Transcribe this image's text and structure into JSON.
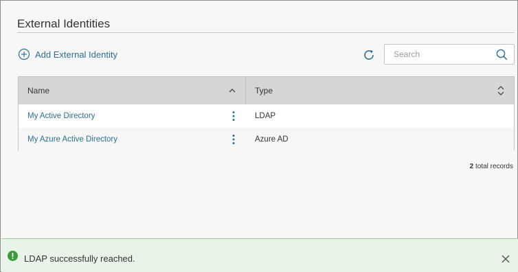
{
  "page": {
    "title": "External Identities"
  },
  "toolbar": {
    "add_label": "Add External Identity",
    "add_icon": "plus-circle-icon",
    "refresh_icon": "refresh-icon",
    "search_placeholder": "Search",
    "search_icon": "search-icon"
  },
  "table": {
    "columns": [
      {
        "label": "Name",
        "sort": "ascending"
      },
      {
        "label": "Type",
        "sort": "unsorted"
      }
    ],
    "rows": [
      {
        "name": "My Active Directory",
        "type": "LDAP"
      },
      {
        "name": "My Azure Active Directory",
        "type": "Azure AD"
      }
    ],
    "total_count": "2",
    "total_suffix": "total records"
  },
  "toast": {
    "message": "LDAP successfully reached.",
    "status": "success",
    "icon": "success-alert-icon",
    "close_icon": "close-icon"
  },
  "colors": {
    "accent": "#2e6f8e",
    "success": "#3c9a3c",
    "toast_bg": "#e9f4e9",
    "header_bg": "#d6d6d6"
  }
}
